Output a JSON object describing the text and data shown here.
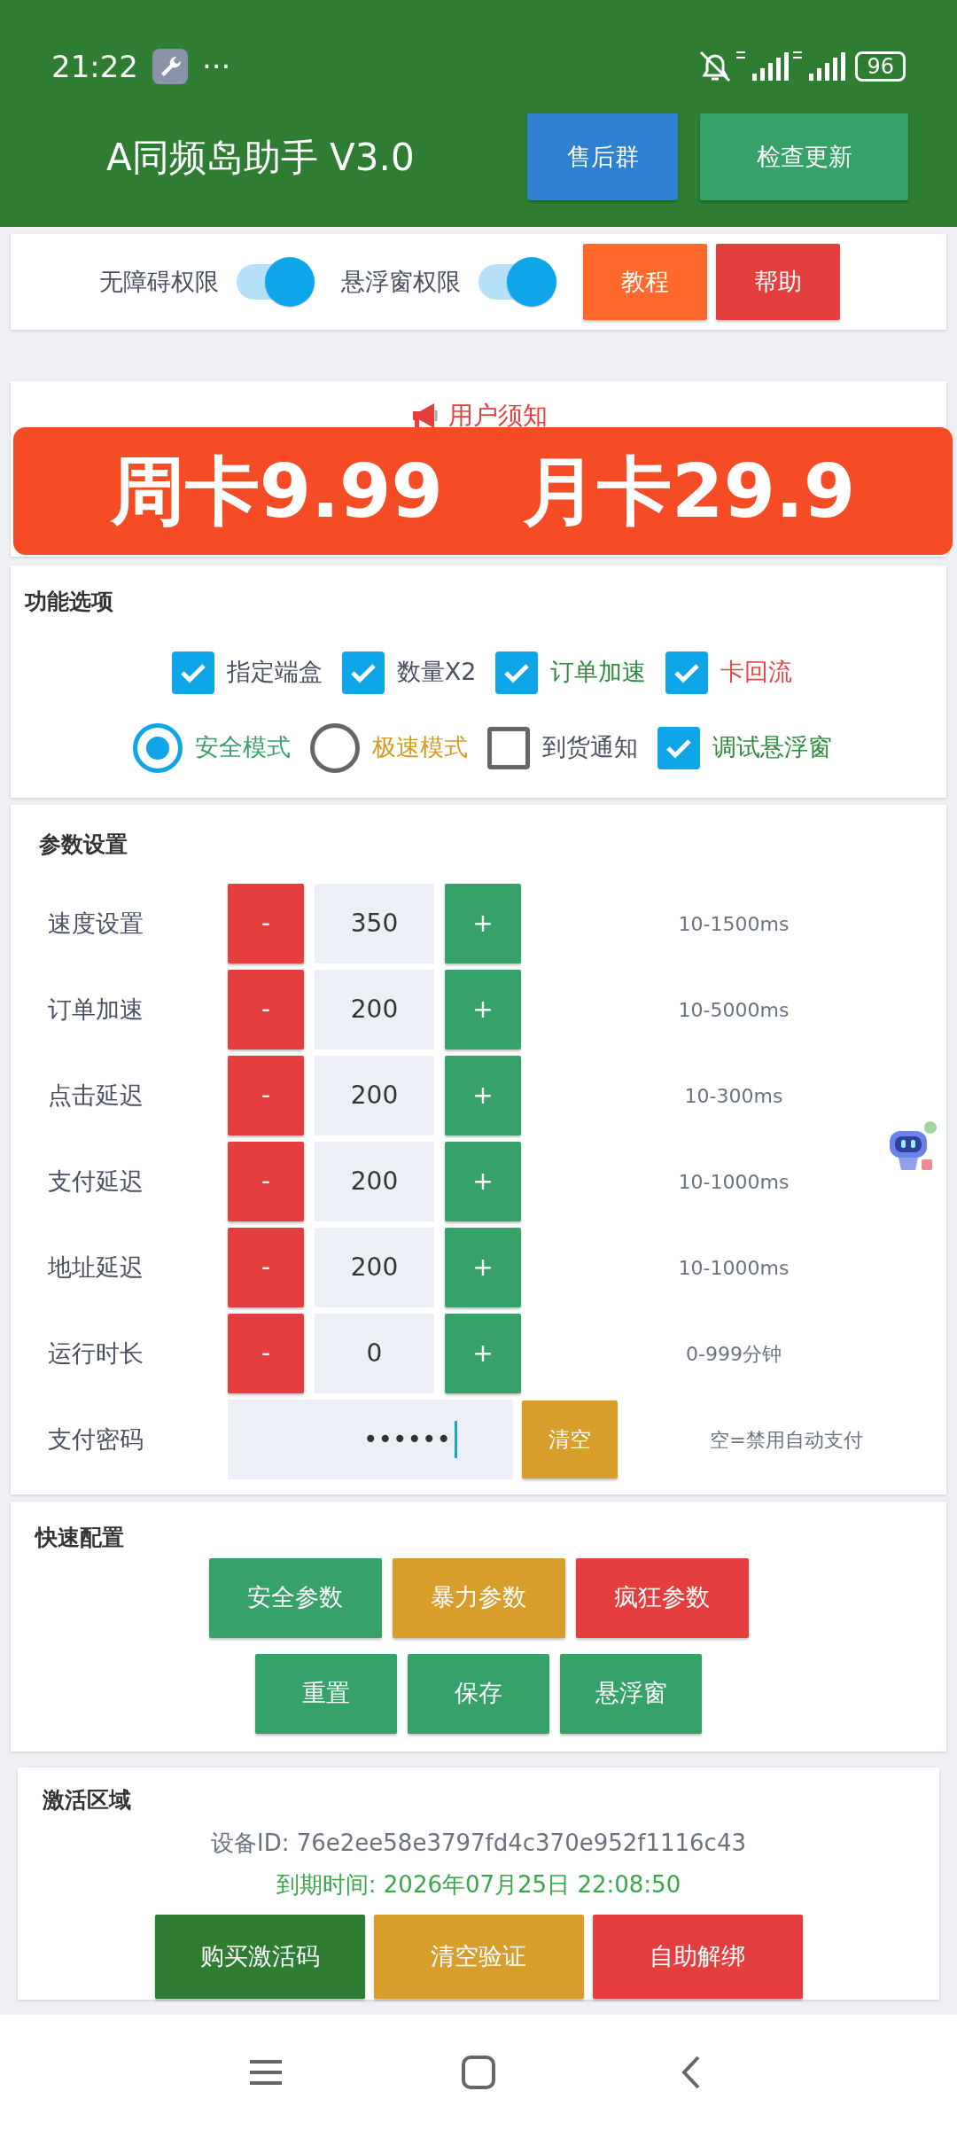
{
  "status_bar": {
    "time": "21:22",
    "more": "···",
    "battery": "96"
  },
  "header": {
    "title": "A同频岛助手 V3.0",
    "buttons": [
      {
        "label": "售后群",
        "color": "#2f80d0"
      },
      {
        "label": "检查更新",
        "color": "#36a269"
      }
    ]
  },
  "permissions": {
    "toggles": [
      {
        "label": "无障碍权限",
        "on": true
      },
      {
        "label": "悬浮窗权限",
        "on": true
      }
    ],
    "buttons": [
      {
        "label": "教程",
        "color": "#ff6a2c"
      },
      {
        "label": "帮助",
        "color": "#e53e3e"
      }
    ]
  },
  "notice": {
    "title": "用户须知"
  },
  "promo": {
    "items": [
      "周卡9.99",
      "月卡29.9"
    ]
  },
  "features": {
    "title": "功能选项",
    "rows": [
      [
        {
          "kind": "checkbox",
          "label": "指定端盒",
          "checked": true,
          "color": "#4a5060"
        },
        {
          "kind": "checkbox",
          "label": "数量X2",
          "checked": true,
          "color": "#4a5060"
        },
        {
          "kind": "checkbox",
          "label": "订单加速",
          "checked": true,
          "color": "#2e8b3e"
        },
        {
          "kind": "checkbox",
          "label": "卡回流",
          "checked": true,
          "color": "#e04848"
        }
      ],
      [
        {
          "kind": "radio",
          "label": "安全模式",
          "checked": true,
          "color": "#36a269"
        },
        {
          "kind": "radio",
          "label": "极速模式",
          "checked": false,
          "color": "#d89a20"
        },
        {
          "kind": "checkbox",
          "label": "到货通知",
          "checked": false,
          "color": "#4a5060"
        },
        {
          "kind": "checkbox",
          "label": "调试悬浮窗",
          "checked": true,
          "color": "#2e8b3e"
        }
      ]
    ]
  },
  "params": {
    "title": "参数设置",
    "rows": [
      {
        "kind": "stepper",
        "label": "速度设置",
        "minus": "-",
        "value": "350",
        "plus": "+",
        "hint": "10-1500ms"
      },
      {
        "kind": "stepper",
        "label": "订单加速",
        "minus": "-",
        "value": "200",
        "plus": "+",
        "hint": "10-5000ms"
      },
      {
        "kind": "stepper",
        "label": "点击延迟",
        "minus": "-",
        "value": "200",
        "plus": "+",
        "hint": "10-300ms"
      },
      {
        "kind": "stepper",
        "label": "支付延迟",
        "minus": "-",
        "value": "200",
        "plus": "+",
        "hint": "10-1000ms"
      },
      {
        "kind": "stepper",
        "label": "地址延迟",
        "minus": "-",
        "value": "200",
        "plus": "+",
        "hint": "10-1000ms"
      },
      {
        "kind": "stepper",
        "label": "运行时长",
        "minus": "-",
        "value": "0",
        "plus": "+",
        "hint": "0-999分钟"
      },
      {
        "kind": "password",
        "label": "支付密码",
        "value": "••••••",
        "button": "清空",
        "hint": "空=禁用自动支付"
      }
    ]
  },
  "quick": {
    "title": "快速配置",
    "rows": [
      [
        {
          "label": "安全参数",
          "color": "#36a269"
        },
        {
          "label": "暴力参数",
          "color": "#d89e2c"
        },
        {
          "label": "疯狂参数",
          "color": "#e53e3e"
        }
      ],
      [
        {
          "label": "重置",
          "color": "#36a269"
        },
        {
          "label": "保存",
          "color": "#36a269"
        },
        {
          "label": "悬浮窗",
          "color": "#36a269"
        }
      ]
    ]
  },
  "activation": {
    "title": "激活区域",
    "device_id": "设备ID: 76e2ee58e3797fd4c370e952f1116c43",
    "expiry": "到期时间: 2026年07月25日 22:08:50",
    "buttons": [
      {
        "label": "购买激活码",
        "color": "#2e7d32"
      },
      {
        "label": "清空验证",
        "color": "#d89e2c"
      },
      {
        "label": "自助解绑",
        "color": "#e53e3e"
      }
    ]
  }
}
